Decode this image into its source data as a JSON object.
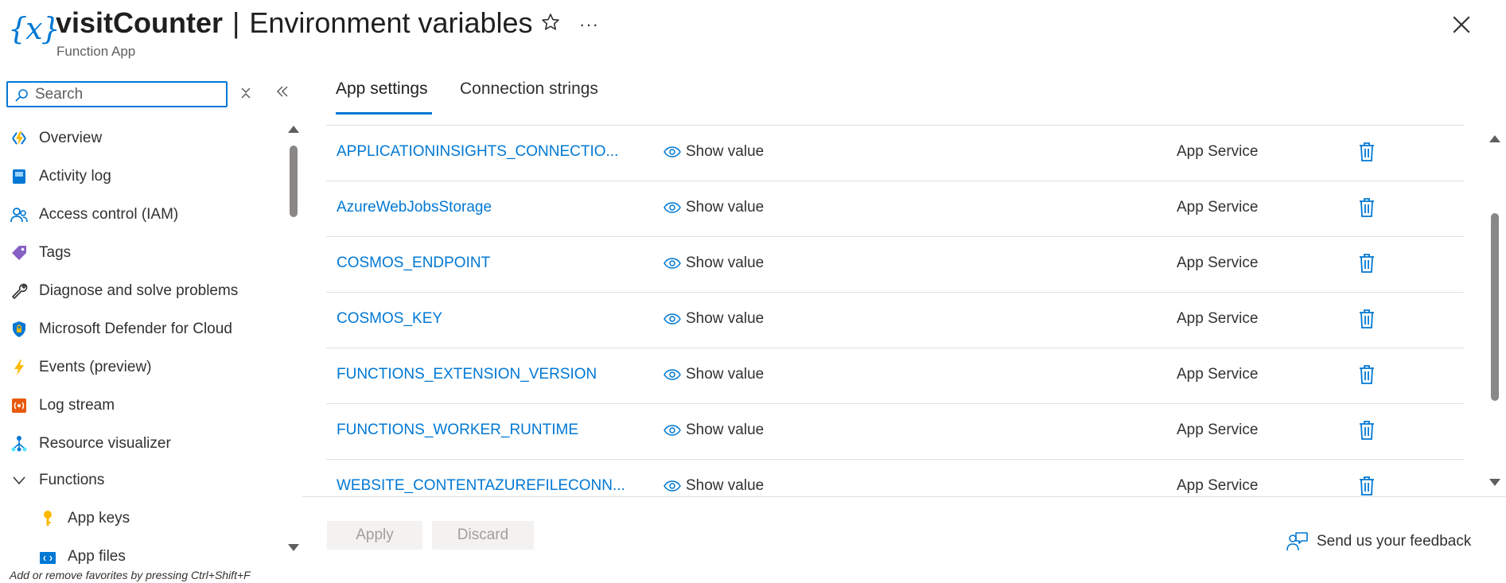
{
  "header": {
    "logo_glyph": "{x}",
    "resource_name": "visitCounter",
    "separator": "|",
    "page_title": "Environment variables",
    "subtitle": "Function App",
    "more_label": "···"
  },
  "sidebar": {
    "search": {
      "placeholder": "Search",
      "value": ""
    },
    "items": [
      {
        "label": "Overview",
        "icon": "lightning-overview-icon"
      },
      {
        "label": "Activity log",
        "icon": "activity-log-icon"
      },
      {
        "label": "Access control (IAM)",
        "icon": "people-icon"
      },
      {
        "label": "Tags",
        "icon": "tag-icon"
      },
      {
        "label": "Diagnose and solve problems",
        "icon": "wrench-icon"
      },
      {
        "label": "Microsoft Defender for Cloud",
        "icon": "shield-icon"
      },
      {
        "label": "Events (preview)",
        "icon": "lightning-icon"
      },
      {
        "label": "Log stream",
        "icon": "log-stream-icon"
      },
      {
        "label": "Resource visualizer",
        "icon": "resource-visualizer-icon"
      },
      {
        "label": "Functions",
        "icon": "chevron-down-icon"
      },
      {
        "label": "App keys",
        "icon": "key-icon"
      },
      {
        "label": "App files",
        "icon": "code-file-icon"
      }
    ],
    "favorites_hint": "Add or remove favorites by pressing Ctrl+Shift+F"
  },
  "main": {
    "tabs": [
      {
        "label": "App settings",
        "active": true
      },
      {
        "label": "Connection strings",
        "active": false
      }
    ],
    "rows": [
      {
        "name": "APPLICATIONINSIGHTS_CONNECTIO...",
        "value": "Show value",
        "source": "App Service"
      },
      {
        "name": "AzureWebJobsStorage",
        "value": "Show value",
        "source": "App Service"
      },
      {
        "name": "COSMOS_ENDPOINT",
        "value": "Show value",
        "source": "App Service"
      },
      {
        "name": "COSMOS_KEY",
        "value": "Show value",
        "source": "App Service"
      },
      {
        "name": "FUNCTIONS_EXTENSION_VERSION",
        "value": "Show value",
        "source": "App Service"
      },
      {
        "name": "FUNCTIONS_WORKER_RUNTIME",
        "value": "Show value",
        "source": "App Service"
      },
      {
        "name": "WEBSITE_CONTENTAZUREFILECONN...",
        "value": "Show value",
        "source": "App Service"
      }
    ],
    "apply_label": "Apply",
    "discard_label": "Discard",
    "feedback_label": "Send us your feedback"
  },
  "colors": {
    "accent": "#0078d4",
    "text": "#323130",
    "disabled_bg": "#f3f2f1",
    "disabled_text": "#a19f9d",
    "divider": "#e1dfdd"
  }
}
